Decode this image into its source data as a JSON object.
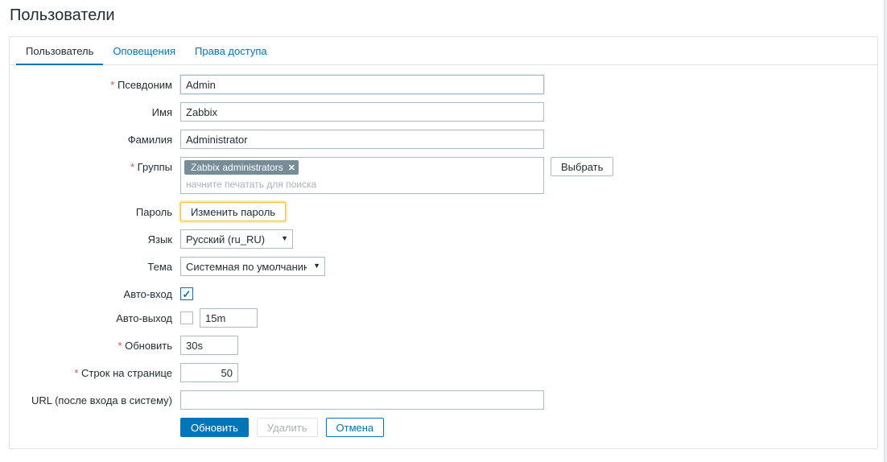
{
  "page": {
    "title": "Пользователи"
  },
  "tabs": [
    {
      "label": "Пользователь",
      "active": true
    },
    {
      "label": "Оповещения",
      "active": false
    },
    {
      "label": "Права доступа",
      "active": false
    }
  ],
  "form": {
    "alias": {
      "label": "Псевдоним",
      "value": "Admin"
    },
    "name": {
      "label": "Имя",
      "value": "Zabbix"
    },
    "surname": {
      "label": "Фамилия",
      "value": "Administrator"
    },
    "groups": {
      "label": "Группы",
      "tags": [
        "Zabbix administrators"
      ],
      "placeholder": "начните печатать для поиска",
      "select_button": "Выбрать"
    },
    "password": {
      "label": "Пароль",
      "change_button": "Изменить пароль"
    },
    "language": {
      "label": "Язык",
      "value": "Русский (ru_RU)"
    },
    "theme": {
      "label": "Тема",
      "value": "Системная по умолчанию"
    },
    "autologin": {
      "label": "Авто-вход",
      "checked": true
    },
    "autologout": {
      "label": "Авто-выход",
      "checked": false,
      "value": "15m"
    },
    "refresh": {
      "label": "Обновить",
      "value": "30s"
    },
    "rows_per_page": {
      "label": "Строк на странице",
      "value": "50"
    },
    "url": {
      "label": "URL (после входа в систему)",
      "value": ""
    }
  },
  "actions": {
    "update": "Обновить",
    "delete": "Удалить",
    "cancel": "Отмена"
  }
}
